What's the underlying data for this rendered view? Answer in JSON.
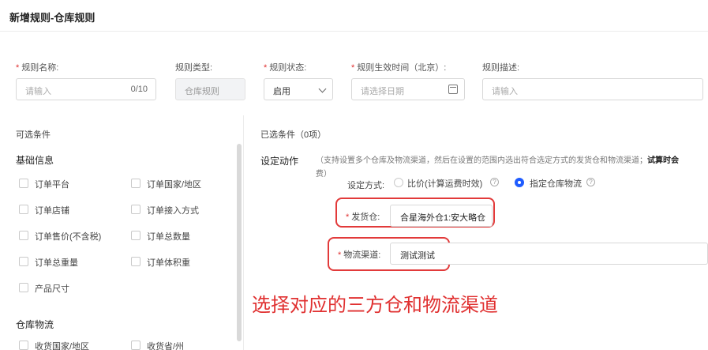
{
  "page": {
    "title": "新增规则-仓库规则"
  },
  "form": {
    "rule_name": {
      "label": "规则名称:",
      "placeholder": "请输入",
      "count": "0/10"
    },
    "rule_type": {
      "label": "规则类型:",
      "value": "仓库规则"
    },
    "rule_status": {
      "label": "规则状态:",
      "value": "启用"
    },
    "effective_time": {
      "label": "规则生效时间（北京）:",
      "placeholder": "请选择日期"
    },
    "rule_desc": {
      "label": "规则描述:",
      "placeholder": "请输入"
    }
  },
  "left_panel": {
    "header": "可选条件",
    "basic_title": "基础信息",
    "basic_items": [
      "订单平台",
      "订单国家/地区",
      "订单店铺",
      "订单接入方式",
      "订单售价(不含税)",
      "订单总数量",
      "订单总重量",
      "订单体积重",
      "产品尺寸"
    ],
    "logistics_title": "仓库物流",
    "logistics_items": [
      "收货国家/地区",
      "收货省/州"
    ]
  },
  "right_panel": {
    "header": "已选条件（0项）",
    "action_label": "设定动作",
    "hint_line1": "（支持设置多个仓库及物流渠道，然后在设置的范围内选出符合选定方式的发货仓和物流渠道；",
    "hint_bold": "试算时会",
    "hint_line2": "费）",
    "ship_method_label": "设定方式:",
    "option_compare": "比价(计算运费时效)",
    "option_specify": "指定仓库物流",
    "warehouse_label": "发货仓:",
    "warehouse_value": "合星海外仓1:安大略仓",
    "channel_label": "物流渠道:",
    "channel_value": "测试测试"
  },
  "annotation": "选择对应的三方仓和物流渠道",
  "colors": {
    "required": "#e03030",
    "accent": "#1f5cff",
    "highlight_box": "#e23a3a"
  }
}
